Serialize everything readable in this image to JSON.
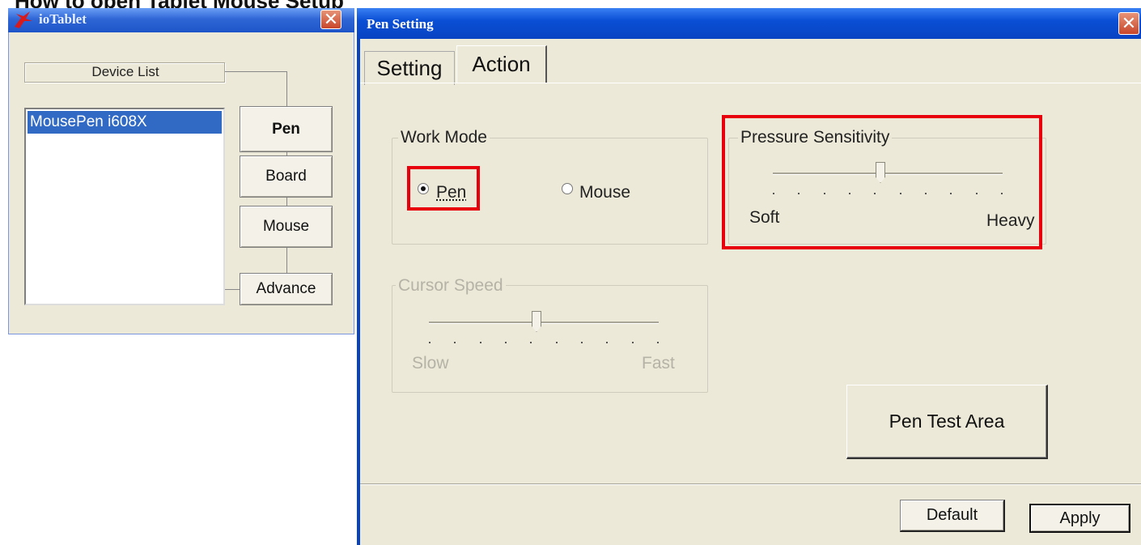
{
  "clipped_heading": "How to open Tablet Mouse Setup",
  "iotablet": {
    "title": "ioTablet",
    "device_list_label": "Device List",
    "devices": [
      "MousePen i608X"
    ],
    "buttons": {
      "pen": "Pen",
      "board": "Board",
      "mouse": "Mouse",
      "advance": "Advance"
    }
  },
  "pen_setting": {
    "title": "Pen Setting",
    "tabs": [
      {
        "label": "Setting"
      },
      {
        "label": "Action"
      }
    ],
    "active_tab": "Action",
    "work_mode": {
      "label": "Work Mode",
      "options": [
        "Pen",
        "Mouse"
      ],
      "selected": "Pen"
    },
    "pressure": {
      "label": "Pressure Sensitivity",
      "min_label": "Soft",
      "max_label": "Heavy",
      "ticks": 10,
      "level": 0.47
    },
    "cursor_speed": {
      "label": "Cursor Speed",
      "min_label": "Slow",
      "max_label": "Fast",
      "ticks": 10,
      "level": 0.47,
      "disabled": true
    },
    "test_area_label": "Pen Test Area",
    "default_label": "Default",
    "apply_label": "Apply"
  },
  "colors": {
    "highlight": "#e8000d",
    "selection": "#316ac5",
    "titlebar": "#0a4fd5"
  }
}
